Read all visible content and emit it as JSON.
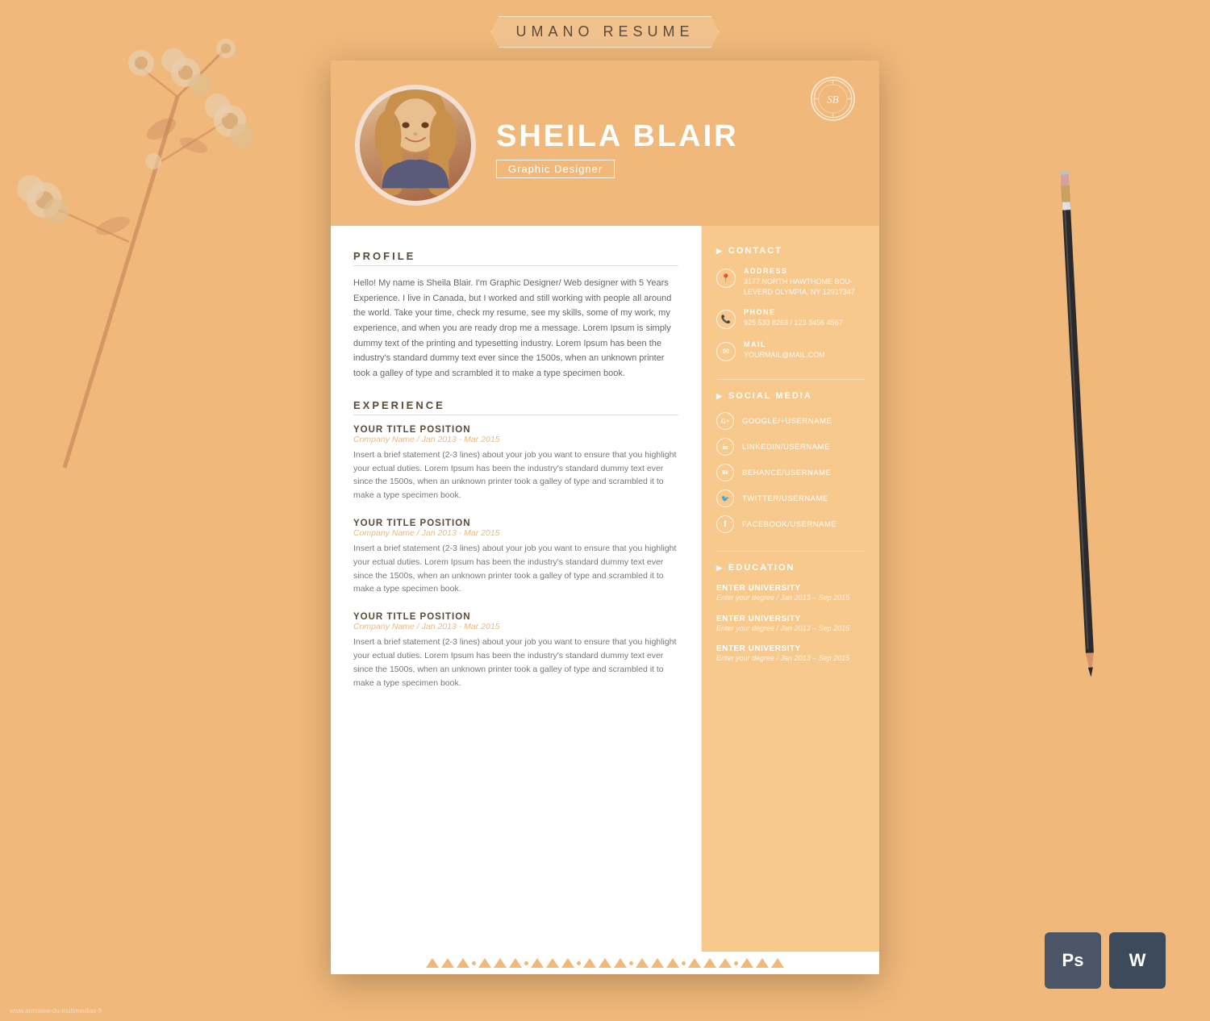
{
  "banner": {
    "text": "UMANO  RESUME"
  },
  "header": {
    "name": "SHEILA BLAIR",
    "job_title": "Graphic Designer",
    "monogram": "SB"
  },
  "profile": {
    "section_label": "PROFILE",
    "text": "Hello! My name is Sheila Blair. I'm Graphic Designer/ Web designer with 5 Years Experience. I live in Canada, but I worked and still working with people all around the world. Take your time, check my resume, see my skills, some of my work, my experience, and when you are ready drop me a message. Lorem Ipsum is simply dummy text of the printing and typesetting industry. Lorem Ipsum has been the industry's standard dummy text ever since the 1500s, when an unknown printer took a galley of type and scrambled it to make a type specimen book."
  },
  "experience": {
    "section_label": "EXPERIENCE",
    "items": [
      {
        "title": "YOUR TITLE POSITION",
        "company": "Company Name / Jan 2013 - Mar 2015",
        "desc": "Insert a brief statement (2-3 lines) about your job you want to ensure that you highlight your ectual duties. Lorem Ipsum has been the industry's standard dummy text ever since the 1500s, when an unknown printer took a galley of type and scrambled it to make a type specimen book."
      },
      {
        "title": "YOUR TITLE POSITION",
        "company": "Company Name / Jan 2013 - Mar 2015",
        "desc": "Insert a brief statement (2-3 lines) about your job you want to ensure that you highlight your ectual duties. Lorem Ipsum has been the industry's standard dummy text ever since the 1500s, when an unknown printer took a galley of type and scrambled it to make a type specimen book."
      },
      {
        "title": "YOUR TITLE POSITION",
        "company": "Company Name / Jan 2013 - Mar 2015",
        "desc": "Insert a brief statement (2-3 lines) about your job you want to ensure that you highlight your ectual duties. Lorem Ipsum has been the industry's standard dummy text ever since the 1500s, when an unknown printer took a galley of type and scrambled it to make a type specimen book."
      }
    ]
  },
  "contact": {
    "section_label": "CONTACT",
    "address_label": "ADDRESS",
    "address_value": "3177 NORTH HAWTHOME BOU-\nLEVERD OLYMPIA, NY 12917347",
    "phone_label": "PHONE",
    "phone_value": "925 533 8263 / 123 3456 4567",
    "mail_label": "MAIL",
    "mail_value": "YOURMAIL@MAIL.COM"
  },
  "social": {
    "section_label": "SOCIAL MEDIA",
    "items": [
      {
        "icon": "G+",
        "label": "GOOGLE/+USERNAME"
      },
      {
        "icon": "in",
        "label": "LINKEDIN/USERNAME"
      },
      {
        "icon": "Be",
        "label": "BEHANCE/USERNAME"
      },
      {
        "icon": "🐦",
        "label": "TWITTER/USERNAME"
      },
      {
        "icon": "f",
        "label": "FACEBOOK/USERNAME"
      }
    ]
  },
  "education": {
    "section_label": "EDUCATION",
    "items": [
      {
        "school": "ENTER UNIVERSITY",
        "detail": "Enter your degree / Jan 2013 – Sep 2015"
      },
      {
        "school": "ENTER UNIVERSITY",
        "detail": "Enter your degree / Jan 2013 – Sep 2015"
      },
      {
        "school": "ENTER UNIVERSITY",
        "detail": "Enter your degree / Jan 2013 – Sep 2015"
      }
    ]
  },
  "apps": {
    "ps_label": "Ps",
    "w_label": "W"
  },
  "watermark": "www.annuaire-du-multimedias-fr"
}
